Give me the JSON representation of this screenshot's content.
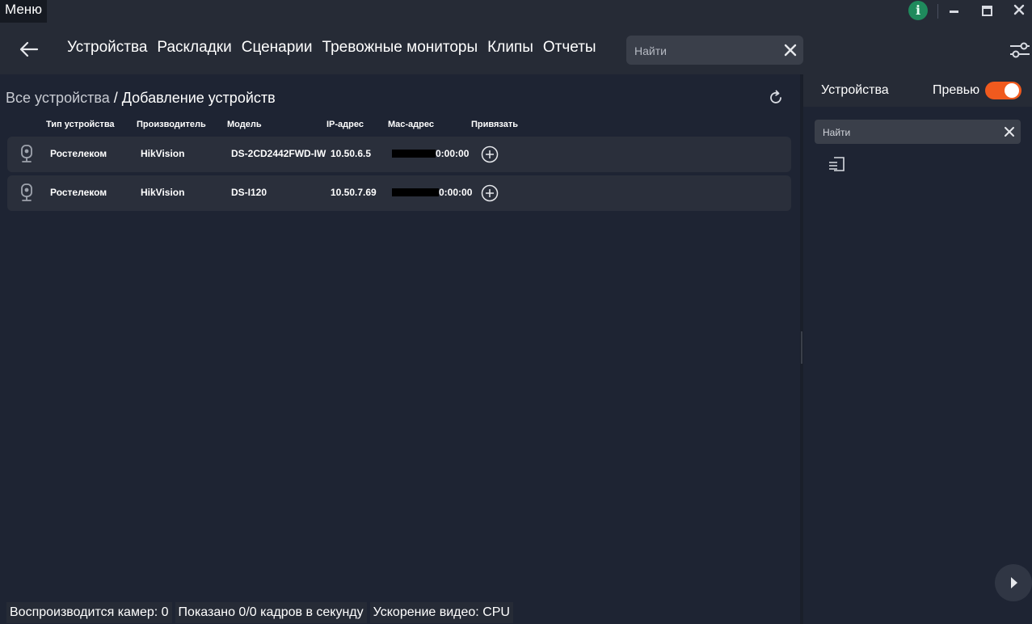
{
  "titlebar": {
    "menu_label": "Меню",
    "info_icon": "info-icon"
  },
  "nav": {
    "tabs": [
      "Устройства",
      "Раскладки",
      "Сценарии",
      "Тревожные мониторы",
      "Клипы",
      "Отчеты"
    ],
    "search_placeholder": "Найти"
  },
  "breadcrumb": {
    "root": "Все устройства",
    "separator": " / ",
    "current": "Добавление устройств"
  },
  "table": {
    "headers": {
      "type": "Тип устройства",
      "vendor": "Производитель",
      "model": "Модель",
      "ip": "IP-адрес",
      "mac": "Mac-адрес",
      "bind": "Привязать"
    },
    "rows": [
      {
        "type": "Ростелеком",
        "vendor": "HikVision",
        "model": "DS-2CD2442FWD-IW",
        "ip": "10.50.6.5",
        "mac_suffix": "0:00:00"
      },
      {
        "type": "Ростелеком",
        "vendor": "HikVision",
        "model": "DS-I120",
        "ip": "10.50.7.69",
        "mac_suffix": "0:00:00"
      }
    ]
  },
  "sidebar": {
    "title": "Устройства",
    "preview_label": "Превью",
    "preview_enabled": true,
    "search_placeholder": "Найти"
  },
  "status": {
    "cameras": "Воспроизводится камер: 0",
    "fps": "Показано 0/0 кадров в секунду",
    "accel": "Ускорение видео: CPU"
  },
  "colors": {
    "accent": "#f05a1e",
    "background": "#1e2433",
    "panel": "#262b36",
    "row": "#2a2f3b",
    "info": "#1f8a5c"
  }
}
